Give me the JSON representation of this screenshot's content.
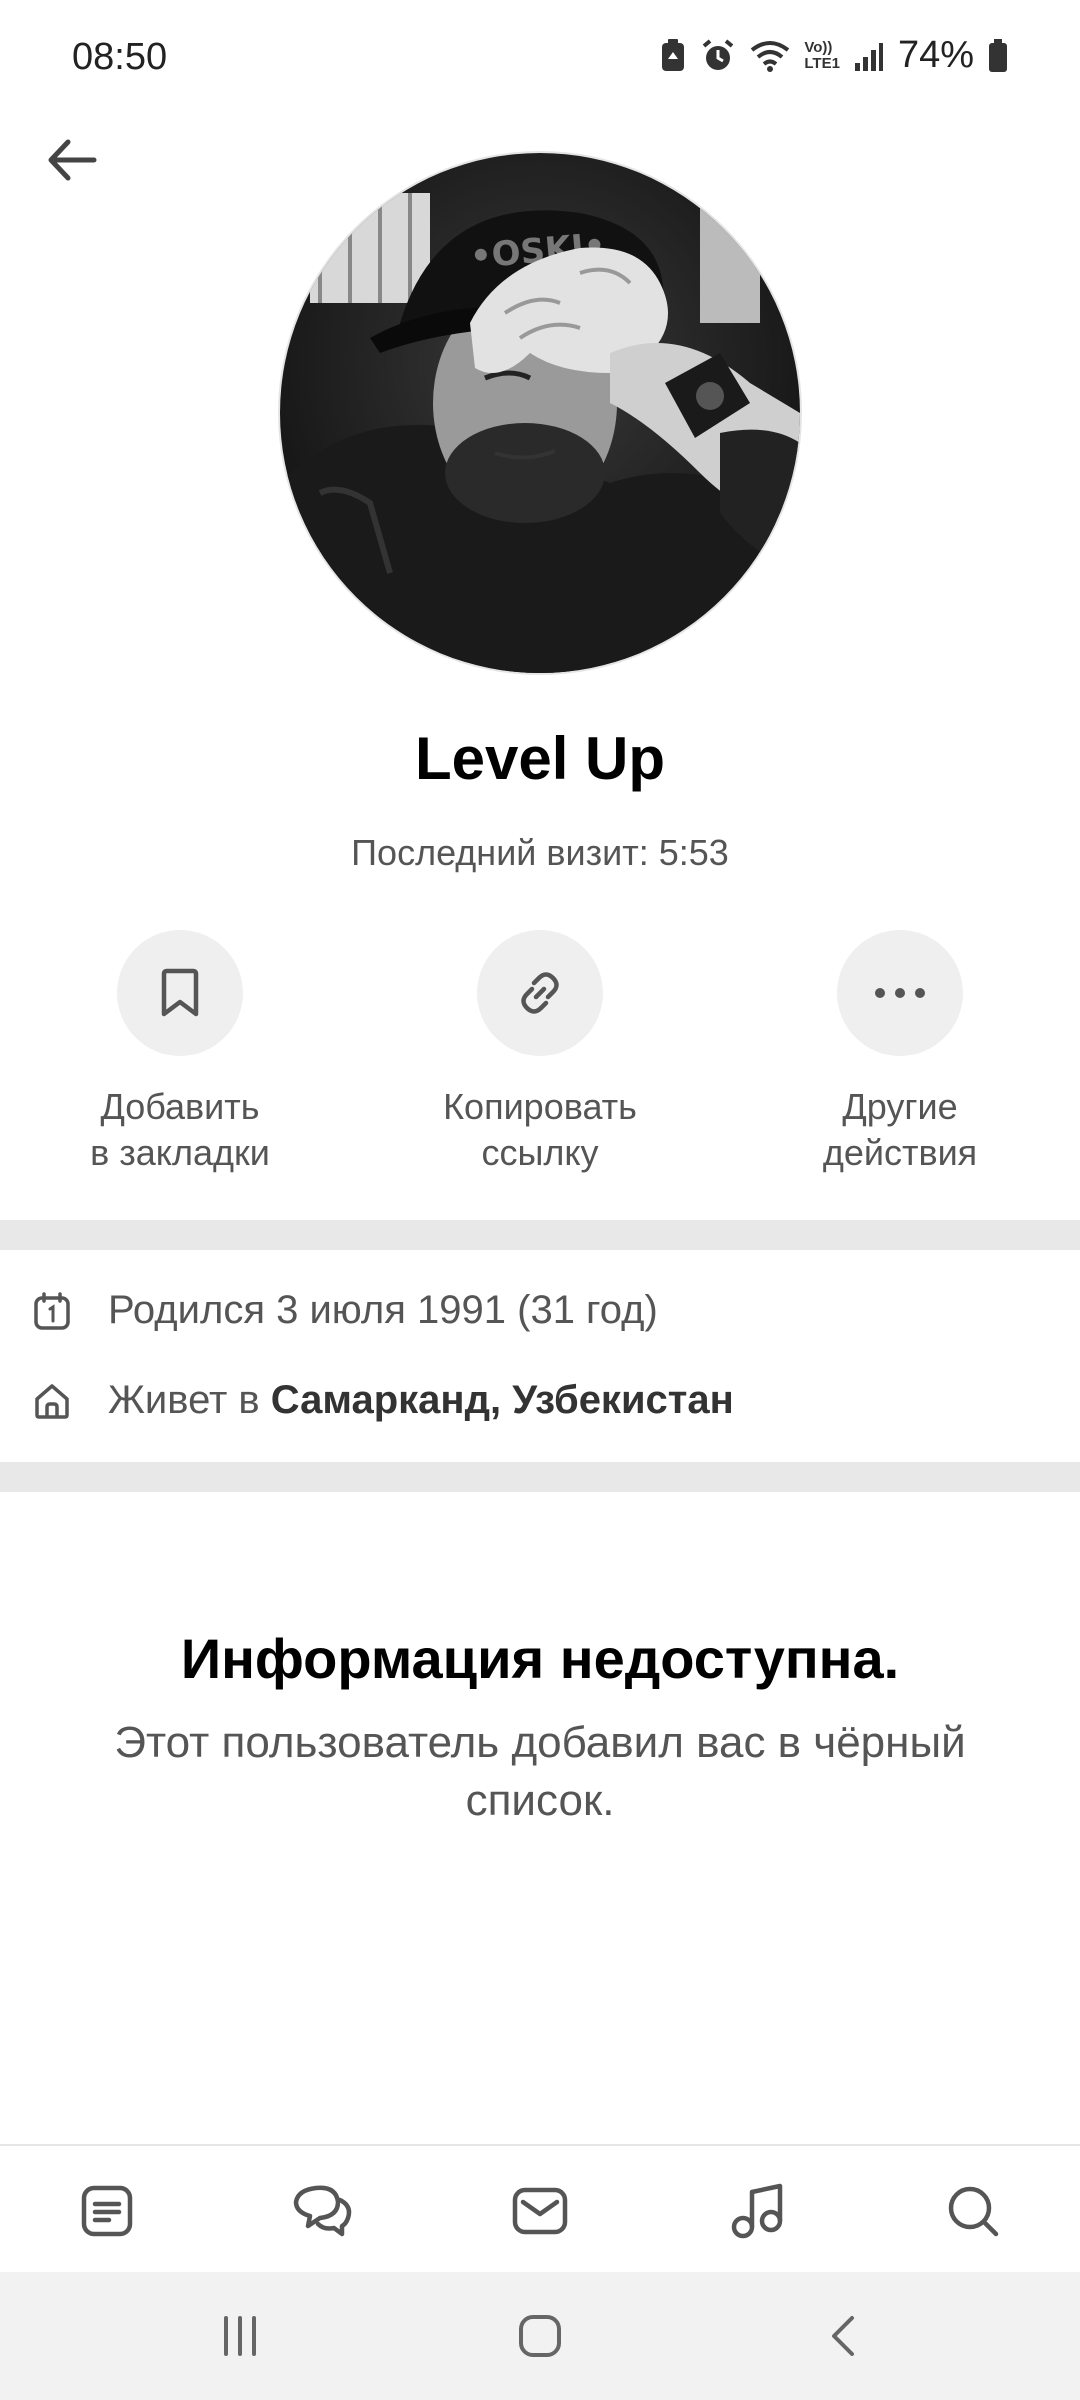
{
  "status_bar": {
    "time": "08:50",
    "icons": [
      "battery-saver-icon",
      "alarm-icon",
      "wifi-icon",
      "volte-lte-icon",
      "signal-icon",
      "battery-icon"
    ],
    "volte_label": "Vo))",
    "lte_label": "LTE1",
    "battery": "74%"
  },
  "profile": {
    "name": "Level Up",
    "last_visit": "Последний визит: 5:53"
  },
  "actions": [
    {
      "label": "Добавить\nв закладки",
      "icon": "bookmark-icon"
    },
    {
      "label": "Копировать\nссылку",
      "icon": "link-icon"
    },
    {
      "label": "Другие\nдействия",
      "icon": "more-icon"
    }
  ],
  "info": {
    "birth": "Родился 3 июля 1991 (31 год)",
    "lives_prefix": "Живет в ",
    "lives_city": "Самарканд, Узбекистан"
  },
  "blocked": {
    "title": "Информация недоступна.",
    "text": "Этот пользователь добавил вас в чёрный список."
  },
  "tabs": [
    "feed-icon",
    "messenger-icon",
    "mail-icon",
    "music-icon",
    "search-icon"
  ],
  "system_nav": [
    "recents-icon",
    "home-icon",
    "back-icon"
  ],
  "colors": {
    "background": "#ffffff",
    "divider": "#e8e8e8",
    "action_circle": "#efefef",
    "icon": "#555555"
  }
}
